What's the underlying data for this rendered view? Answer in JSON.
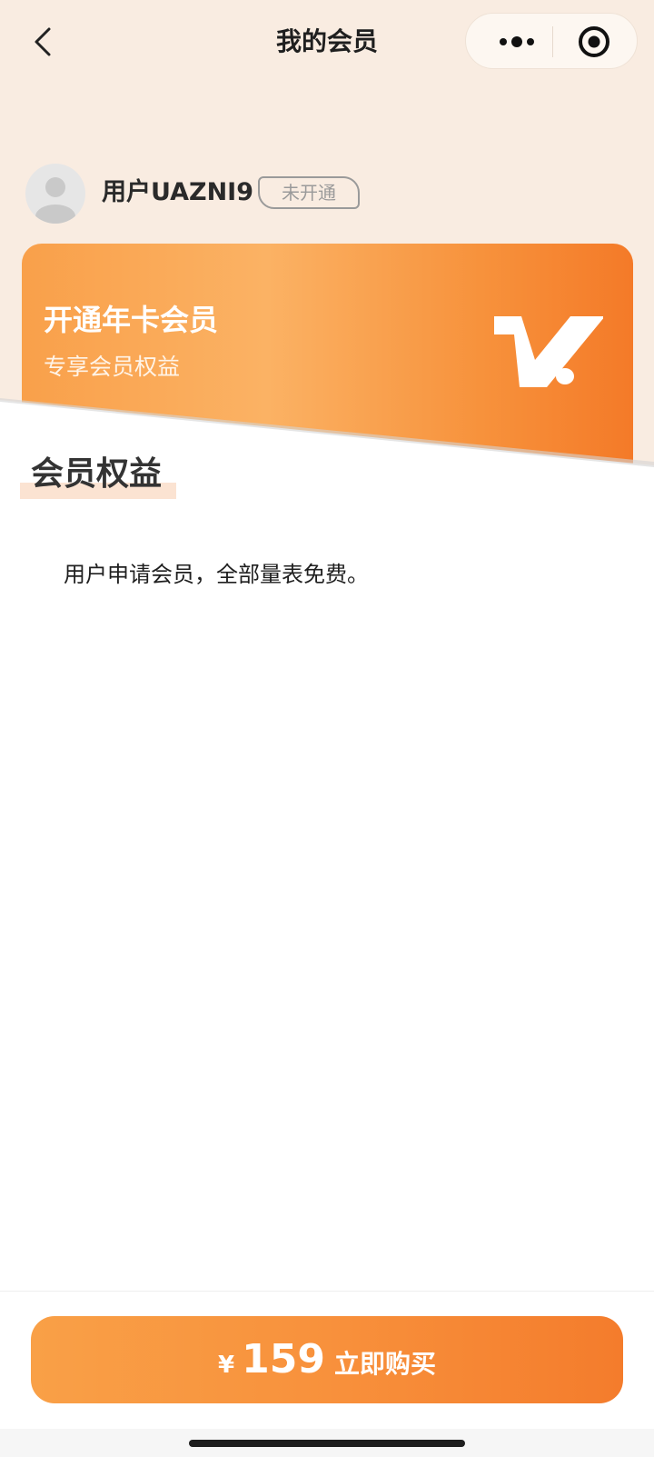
{
  "nav": {
    "title": "我的会员"
  },
  "user": {
    "name": "用户UAZNI9",
    "status": "未开通"
  },
  "card": {
    "title": "开通年卡会员",
    "subtitle": "专享会员权益"
  },
  "benefits": {
    "title": "会员权益",
    "description": "用户申请会员，全部量表免费。"
  },
  "purchase": {
    "currency": "¥",
    "price": "159",
    "label": "立即购买"
  },
  "colors": {
    "accent": "#f7913c",
    "background_top": "#f9ece1"
  },
  "icons": [
    "back-arrow-icon",
    "more-dots-icon",
    "target-icon",
    "avatar-icon",
    "vip-logo-icon"
  ]
}
